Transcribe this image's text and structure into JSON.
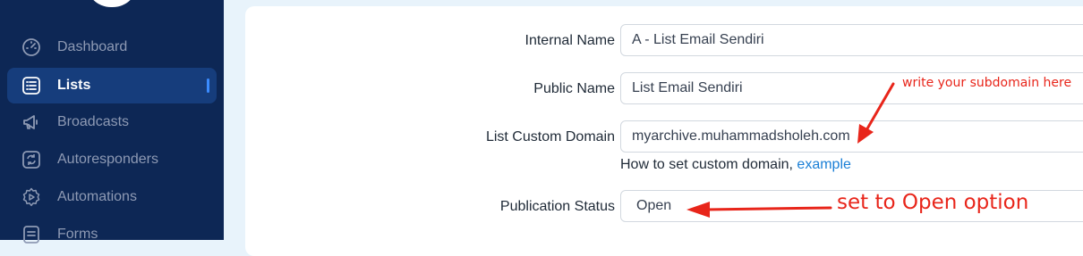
{
  "sidebar": {
    "items": [
      {
        "label": "Dashboard",
        "icon": "dashboard-icon"
      },
      {
        "label": "Lists",
        "icon": "list-icon",
        "active": true
      },
      {
        "label": "Broadcasts",
        "icon": "megaphone-icon"
      },
      {
        "label": "Autoresponders",
        "icon": "refresh-icon"
      },
      {
        "label": "Automations",
        "icon": "gear-play-icon"
      },
      {
        "label": "Forms",
        "icon": "form-icon"
      }
    ]
  },
  "form": {
    "internal_name": {
      "label": "Internal Name",
      "value": "A - List Email Sendiri"
    },
    "public_name": {
      "label": "Public Name",
      "value": "List Email Sendiri"
    },
    "custom_domain": {
      "label": "List Custom Domain",
      "value": "myarchive.muhammadsholeh.com",
      "help_text": "How to set custom domain,",
      "help_link": "example"
    },
    "publication_status": {
      "label": "Publication Status",
      "value": "Open"
    }
  },
  "annotations": {
    "subdomain_note": "write your subdomain here",
    "status_note": "set to Open option"
  },
  "colors": {
    "sidebar_bg": "#0d2755",
    "sidebar_active": "#163d7c",
    "link": "#1a7fd6",
    "annotation": "#e8251a"
  }
}
